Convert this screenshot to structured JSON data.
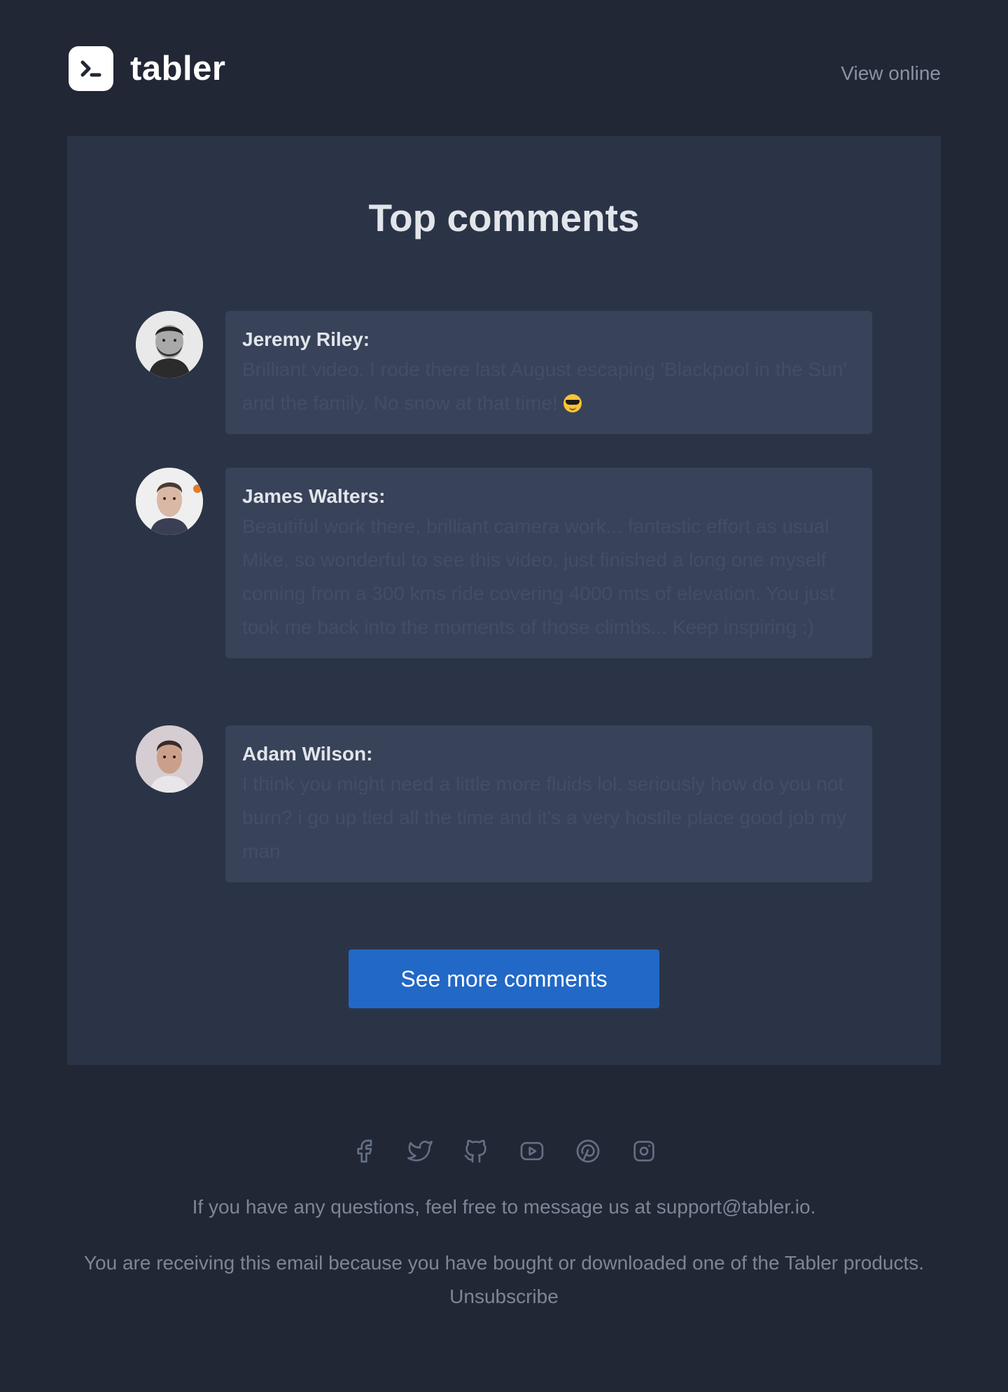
{
  "header": {
    "brand": "tabler",
    "view_online": "View online"
  },
  "main": {
    "title": "Top comments",
    "comments": [
      {
        "author": "Jeremy Riley:",
        "text": "Brilliant video. I rode there last August escaping 'Blackpool in the Sun' and the family. No snow at that time!",
        "emoji": "smiling-face-with-sunglasses"
      },
      {
        "author": "James Walters:",
        "text": "Beautiful work there, brilliant camera work... fantastic effort as usual Mike, so wonderful to see this video, just finished a long one myself coming from a 300 kms ride covering 4000 mts of elevation. You just took me back into the moments of those climbs... Keep inspiring :)"
      },
      {
        "author": "Adam Wilson:",
        "text": "I think you might need a little more fluids lol. seriously how do you not burn? i go up tied all the time and it's a very hostile place good job my man"
      }
    ],
    "button": "See more comments"
  },
  "footer": {
    "social_icons": [
      "facebook-icon",
      "twitter-icon",
      "github-icon",
      "youtube-icon",
      "pinterest-icon",
      "instagram-icon"
    ],
    "questions_prefix": "If you have any questions, feel free to message us at ",
    "support_email": "support@tabler.io",
    "questions_suffix": ".",
    "receiving_text": "You are receiving this email because you have bought or downloaded one of the Tabler products. ",
    "unsubscribe": "Unsubscribe"
  },
  "colors": {
    "page_bg": "#212734",
    "card_bg": "#2b3447",
    "bubble_bg": "#38435a",
    "button_bg": "#2268c6",
    "muted_text": "#7d8697"
  }
}
